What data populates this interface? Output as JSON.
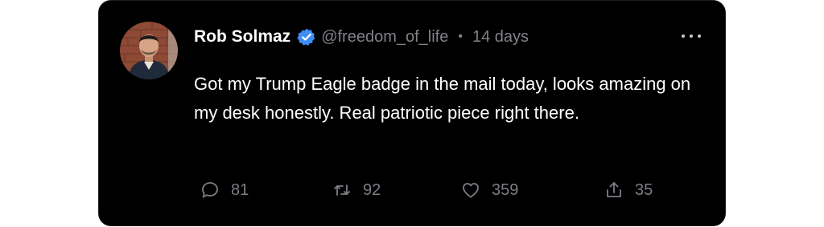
{
  "tweet": {
    "author_name": "Rob Solmaz",
    "handle": "@freedom_of_life",
    "separator": "•",
    "time": "14 days",
    "text": "Got my Trump Eagle badge in the mail today, looks amazing on my desk honestly. Real patriotic piece right there.",
    "verified_icon": "verified-badge-icon",
    "accent_color": "#3f8ef6"
  },
  "actions": {
    "reply_count": "81",
    "retweet_count": "92",
    "like_count": "359",
    "share_count": "35"
  },
  "colors": {
    "card_background": "#000000",
    "muted_text": "#808288",
    "primary_text": "#ffffff"
  }
}
